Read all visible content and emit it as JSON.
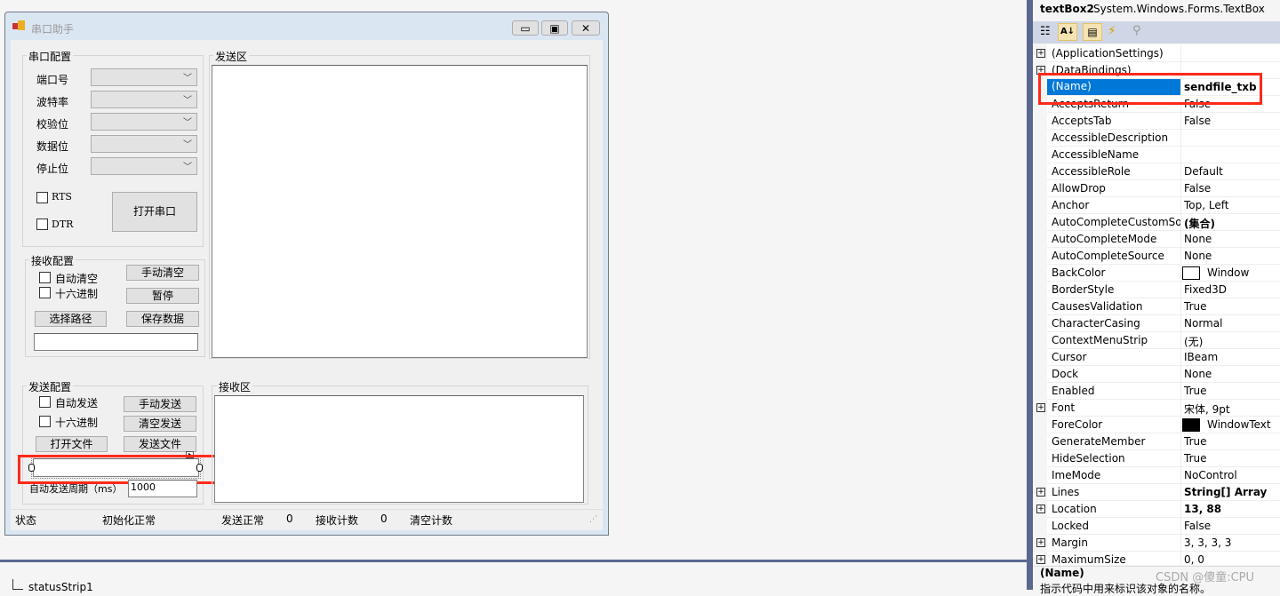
{
  "form": {
    "title": "串口助手",
    "serial_group": {
      "title": "串口配置",
      "labels": [
        "端口号",
        "波特率",
        "校验位",
        "数据位",
        "停止位"
      ],
      "rts": "RTS",
      "dtr": "DTR",
      "open_button": "打开串口"
    },
    "receive_group": {
      "title": "接收配置",
      "auto_clear": "自动清空",
      "hex": "十六进制",
      "manual_clear": "手动清空",
      "pause": "暂停",
      "choose_path": "选择路径",
      "save_data": "保存数据"
    },
    "send_area": {
      "title": "发送区"
    },
    "send_group": {
      "title": "发送配置",
      "auto_send": "自动发送",
      "hex": "十六进制",
      "manual_send": "手动发送",
      "clear_send": "清空发送",
      "open_file": "打开文件",
      "send_file": "发送文件",
      "period_label": "自动发送周期（ms）",
      "period_value": "1000"
    },
    "receive_area": {
      "title": "接收区"
    },
    "status": {
      "label": "状态",
      "init": "初始化正常",
      "send_ok": "发送正常",
      "send_count": "0",
      "recv_label": "接收计数",
      "recv_count": "0",
      "clear_count": "清空计数"
    }
  },
  "designer": {
    "component_tray": "statusStrip1"
  },
  "properties": {
    "object_name": "textBox2",
    "object_type": "System.Windows.Forms.TextBox",
    "rows": [
      {
        "name": "(ApplicationSettings)",
        "value": "",
        "expand": true
      },
      {
        "name": "(DataBindings)",
        "value": "",
        "expand": true
      },
      {
        "name": "(Name)",
        "value": "sendfile_txb",
        "bold": true,
        "selected": true
      },
      {
        "name": "AcceptsReturn",
        "value": "False"
      },
      {
        "name": "AcceptsTab",
        "value": "False"
      },
      {
        "name": "AccessibleDescription",
        "value": ""
      },
      {
        "name": "AccessibleName",
        "value": ""
      },
      {
        "name": "AccessibleRole",
        "value": "Default"
      },
      {
        "name": "AllowDrop",
        "value": "False"
      },
      {
        "name": "Anchor",
        "value": "Top, Left"
      },
      {
        "name": "AutoCompleteCustomSource",
        "value": "(集合)",
        "bold": true
      },
      {
        "name": "AutoCompleteMode",
        "value": "None"
      },
      {
        "name": "AutoCompleteSource",
        "value": "None"
      },
      {
        "name": "BackColor",
        "value": "Window",
        "swatch": "#ffffff"
      },
      {
        "name": "BorderStyle",
        "value": "Fixed3D"
      },
      {
        "name": "CausesValidation",
        "value": "True"
      },
      {
        "name": "CharacterCasing",
        "value": "Normal"
      },
      {
        "name": "ContextMenuStrip",
        "value": "(无)"
      },
      {
        "name": "Cursor",
        "value": "IBeam"
      },
      {
        "name": "Dock",
        "value": "None"
      },
      {
        "name": "Enabled",
        "value": "True"
      },
      {
        "name": "Font",
        "value": "宋体, 9pt",
        "expand": true
      },
      {
        "name": "ForeColor",
        "value": "WindowText",
        "swatch": "#000000"
      },
      {
        "name": "GenerateMember",
        "value": "True"
      },
      {
        "name": "HideSelection",
        "value": "True"
      },
      {
        "name": "ImeMode",
        "value": "NoControl"
      },
      {
        "name": "Lines",
        "value": "String[] Array",
        "bold": true,
        "expand": true
      },
      {
        "name": "Location",
        "value": "13, 88",
        "bold": true,
        "expand": true
      },
      {
        "name": "Locked",
        "value": "False"
      },
      {
        "name": "Margin",
        "value": "3, 3, 3, 3",
        "expand": true
      },
      {
        "name": "MaximumSize",
        "value": "0, 0",
        "expand": true
      }
    ],
    "description_title": "(Name)",
    "description_text": "指示代码中用来标识该对象的名称。"
  },
  "watermark": "CSDN @傻童:CPU",
  "colors": {
    "selection": "#0078d7",
    "highlight_box": "#ff0000"
  }
}
